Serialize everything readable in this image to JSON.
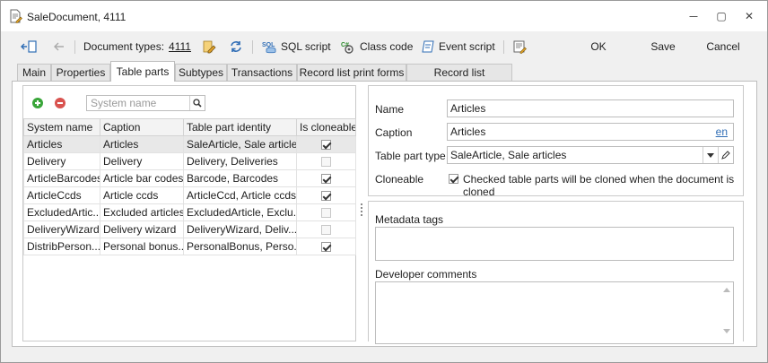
{
  "window": {
    "title": "SaleDocument, 4111",
    "minimize_glyph": "—",
    "maximize_glyph": "▢",
    "close_glyph": "✕"
  },
  "toolbar": {
    "document_types_label": "Document types:",
    "document_types_value": "4111",
    "sql_script": "SQL script",
    "class_code": "Class code",
    "event_script": "Event script",
    "ok": "OK",
    "save": "Save",
    "cancel": "Cancel"
  },
  "tabs": [
    {
      "label": "Main"
    },
    {
      "label": "Properties"
    },
    {
      "label": "Table parts"
    },
    {
      "label": "Subtypes"
    },
    {
      "label": "Transactions"
    },
    {
      "label": "Record list print forms"
    },
    {
      "label": "Record list commands"
    }
  ],
  "active_tab": "Table parts",
  "search": {
    "placeholder": "System name",
    "value": ""
  },
  "grid": {
    "columns": [
      "System name",
      "Caption",
      "Table part identity",
      "Is cloneable"
    ],
    "rows": [
      {
        "system_name": "Articles",
        "caption": "Articles",
        "identity": "SaleArticle, Sale articles",
        "cloneable": true
      },
      {
        "system_name": "Delivery",
        "caption": "Delivery",
        "identity": "Delivery, Deliveries",
        "cloneable": false
      },
      {
        "system_name": "ArticleBarcodes",
        "caption": "Article bar codes",
        "identity": "Barcode, Barcodes",
        "cloneable": true
      },
      {
        "system_name": "ArticleCcds",
        "caption": "Article ccds",
        "identity": "ArticleCcd, Article ccds",
        "cloneable": true
      },
      {
        "system_name": "ExcludedArtic...",
        "caption": "Excluded articles",
        "identity": "ExcludedArticle, Exclu...",
        "cloneable": false
      },
      {
        "system_name": "DeliveryWizard",
        "caption": "Delivery wizard",
        "identity": "DeliveryWizard, Deliv...",
        "cloneable": false
      },
      {
        "system_name": "DistribPerson...",
        "caption": "Personal bonus...",
        "identity": "PersonalBonus, Perso...",
        "cloneable": true
      }
    ],
    "selected_row": 0
  },
  "details": {
    "name_label": "Name",
    "name_value": "Articles",
    "caption_label": "Caption",
    "caption_value": "Articles",
    "caption_lang": "en",
    "type_label": "Table part type",
    "type_value": "SaleArticle, Sale articles",
    "cloneable_label": "Cloneable",
    "cloneable_checked": true,
    "cloneable_text": "Checked table parts will be cloned when the document is cloned",
    "metadata_tags_label": "Metadata tags",
    "metadata_tags_value": "",
    "developer_comments_label": "Developer comments",
    "developer_comments_value": ""
  },
  "colors": {
    "accent_green": "#3aa63a",
    "accent_red": "#d9534f",
    "icon_blue": "#2f6db5",
    "icon_orange": "#e2a227"
  }
}
